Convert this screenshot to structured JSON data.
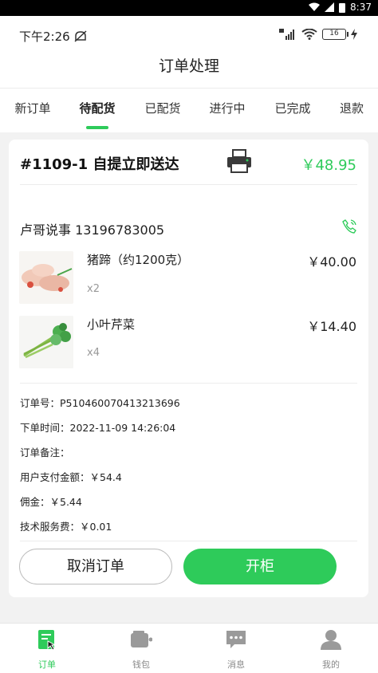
{
  "system_bar": {
    "time": "8:37"
  },
  "app_status": {
    "time": "下午2:26",
    "battery": "16"
  },
  "title": "订单处理",
  "tabs": [
    {
      "label": "新订单"
    },
    {
      "label": "待配货",
      "active": true
    },
    {
      "label": "已配货"
    },
    {
      "label": "进行中"
    },
    {
      "label": "已完成"
    },
    {
      "label": "退款"
    }
  ],
  "order": {
    "title": "#1109-1 自提立即送达",
    "total": "￥48.95",
    "customer": "卢哥说事 13196783005",
    "items": [
      {
        "name": "猪蹄（约1200克）",
        "qty": "x2",
        "price": "￥40.00",
        "image": "pig-trotter-image"
      },
      {
        "name": "小叶芹菜",
        "qty": "x4",
        "price": "￥14.40",
        "image": "celery-image"
      }
    ],
    "info": {
      "order_no": "订单号：P510460070413213696",
      "order_time": "下单时间：2022-11-09 14:26:04",
      "remark": "订单备注：",
      "paid": "用户支付金额：￥54.4",
      "commission": "佣金：￥5.44",
      "service_fee": "技术服务费：￥0.01"
    },
    "cancel_label": "取消订单",
    "open_label": "开柜"
  },
  "bottom_nav": [
    {
      "label": "订单",
      "icon": "order-icon",
      "active": true
    },
    {
      "label": "钱包",
      "icon": "wallet-icon"
    },
    {
      "label": "消息",
      "icon": "message-icon"
    },
    {
      "label": "我的",
      "icon": "profile-icon"
    }
  ],
  "colors": {
    "accent": "#2ecb5a"
  }
}
